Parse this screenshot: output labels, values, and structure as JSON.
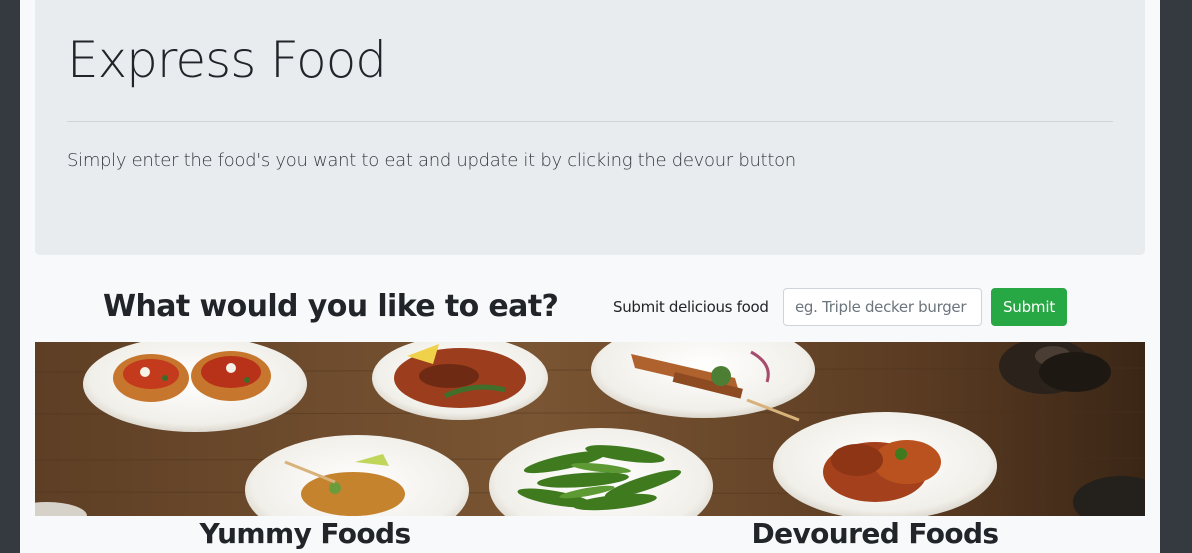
{
  "jumbotron": {
    "title": "Express Food",
    "lead": "Simply enter the food's you want to eat and update it by clicking the devour button"
  },
  "order_form": {
    "heading": "What would you like to eat?",
    "label": "Submit delicious food",
    "input_placeholder": "eg. Triple decker burger",
    "input_value": "",
    "submit_label": "Submit"
  },
  "banner": {
    "description": "photo of plated dishes on a wooden table"
  },
  "columns": {
    "yummy_title": "Yummy Foods",
    "devoured_title": "Devoured Foods"
  },
  "colors": {
    "background": "#343a40",
    "page": "#f8f9fa",
    "jumbotron": "#e9ecef",
    "submit_button": "#28a745",
    "table_wood": "#6b4a2e",
    "plate": "#f3f1ec"
  }
}
